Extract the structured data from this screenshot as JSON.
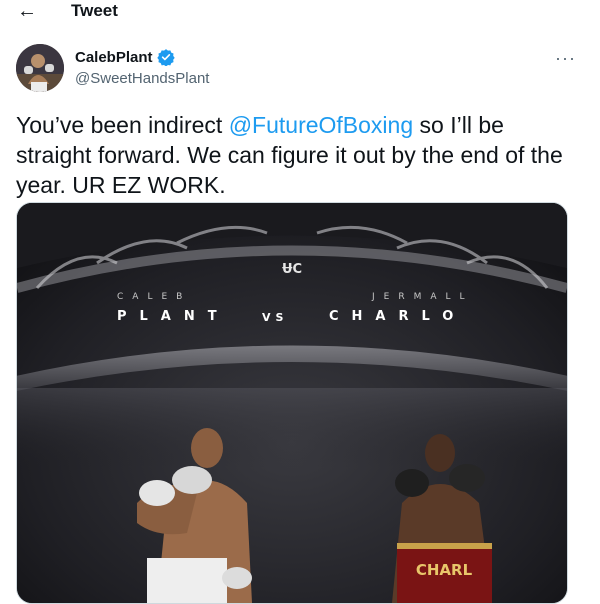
{
  "header": {
    "back_icon": "arrow-left-icon",
    "title": "Tweet"
  },
  "tweet": {
    "author": {
      "display_name": "CalebPlant",
      "handle": "@SweetHandsPlant",
      "verified": true,
      "verified_color": "#1d9bf0"
    },
    "more_icon": "more-horizontal-icon",
    "text_parts": {
      "before": "You’ve been indirect ",
      "mention": "@FutureOfBoxing",
      "after": " so I’ll be straight forward. We can figure it out by the end of the year. UR EZ WORK."
    },
    "link_color": "#1d9bf0"
  },
  "media": {
    "logo_text": "ɄCᴳ",
    "fighter_left": {
      "first": "CALEB",
      "last": "PLANT"
    },
    "vs": "VS",
    "fighter_right": {
      "first": "JERMALL",
      "last": "CHARLO"
    },
    "trunks_text": "CHARL"
  }
}
